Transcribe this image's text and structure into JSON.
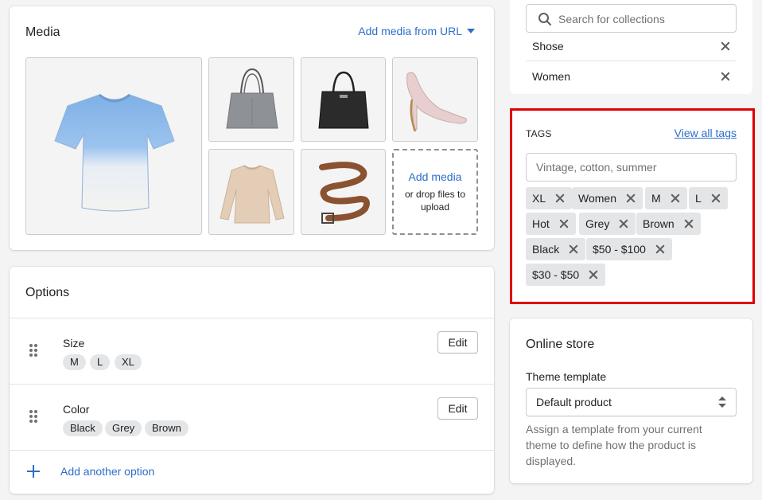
{
  "media": {
    "title": "Media",
    "add_from_url": "Add media from URL",
    "images": [
      "t-shirt",
      "grey-handbag",
      "black-handbag",
      "pink-heel",
      "beige-sweater",
      "brown-belt"
    ],
    "drop_add": "Add media",
    "drop_hint": "or drop files to upload"
  },
  "options": {
    "title": "Options",
    "items": [
      {
        "name": "Size",
        "values": [
          "M",
          "L",
          "XL"
        ],
        "edit_label": "Edit"
      },
      {
        "name": "Color",
        "values": [
          "Black",
          "Grey",
          "Brown"
        ],
        "edit_label": "Edit"
      }
    ],
    "add_label": "Add another option"
  },
  "collections": {
    "search_placeholder": "Search for collections",
    "items": [
      "Shose",
      "Women"
    ]
  },
  "tags": {
    "heading": "TAGS",
    "view_all": "View all tags",
    "input_placeholder": "Vintage, cotton, summer",
    "items": [
      "XL",
      "Women",
      "M",
      "L",
      "Hot",
      "Grey",
      "Brown",
      "Black",
      "$50 - $100",
      "$30 - $50"
    ],
    "highlight_color": "#e00000"
  },
  "online_store": {
    "title": "Online store",
    "theme_label": "Theme template",
    "theme_value": "Default product",
    "help": "Assign a template from your current theme to define how the product is displayed."
  },
  "colors": {
    "link": "#2c6ecb",
    "background": "#f4f4f4"
  }
}
